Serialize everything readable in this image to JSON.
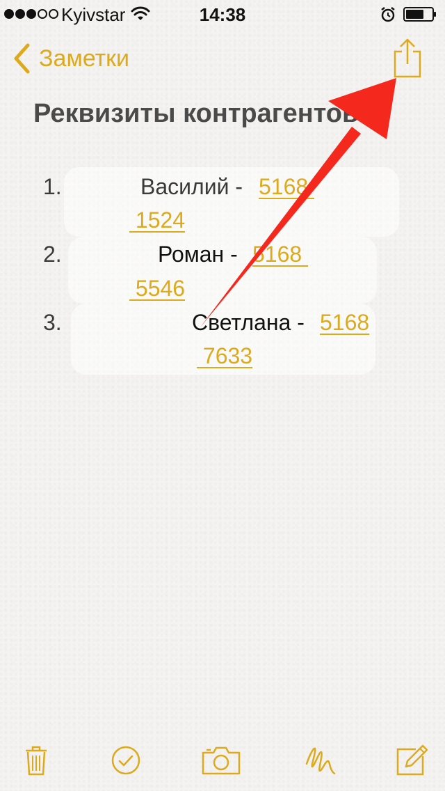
{
  "status_bar": {
    "carrier": "Kyivstar",
    "time": "14:38",
    "signal_bars_filled": 3,
    "signal_bars_total": 5
  },
  "nav": {
    "back_label": "Заметки",
    "back_icon": "chevron-left-icon",
    "share_icon": "share-icon"
  },
  "note": {
    "title": "Реквизиты контрагентов",
    "items": [
      {
        "number": "1.",
        "name": "Василий - ",
        "card_line1": "5168 ",
        "card_line2": " 1524"
      },
      {
        "number": "2.",
        "name": "Роман - ",
        "card_line1": "5168 ",
        "card_line2": " 5546"
      },
      {
        "number": "3.",
        "name": "Светлана - ",
        "card_line1": "5168",
        "card_line2": " 7633"
      }
    ]
  },
  "toolbar": {
    "trash_icon": "trash-icon",
    "checklist_icon": "checklist-icon",
    "camera_icon": "camera-icon",
    "sketch_icon": "sketch-icon",
    "compose_icon": "compose-icon"
  },
  "colors": {
    "accent": "#dcaa1c",
    "annotation_arrow": "#f5281e",
    "background": "#f4f3f1"
  }
}
